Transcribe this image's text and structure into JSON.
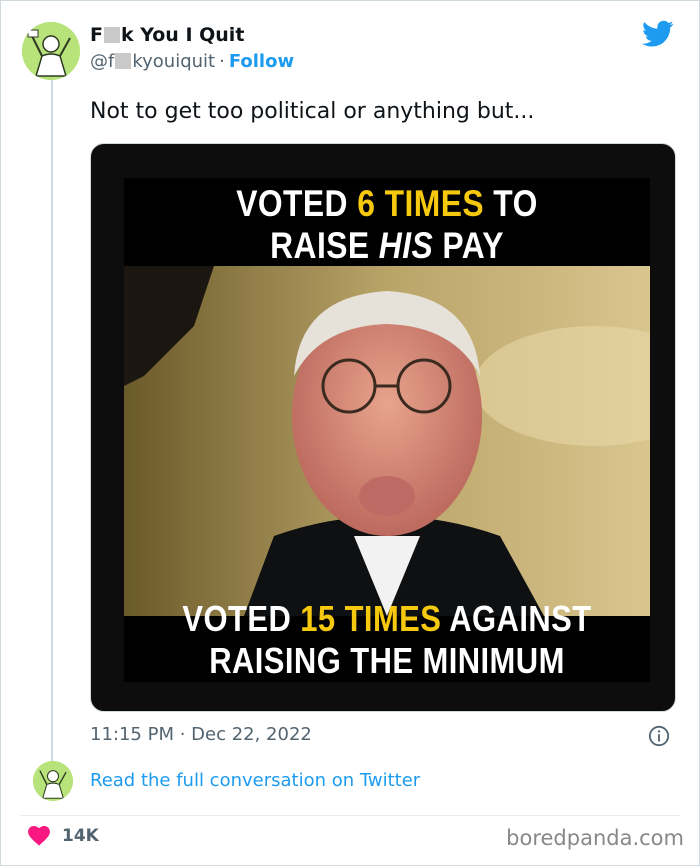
{
  "tweet": {
    "author_name": "F  k You I Quit",
    "author_name_prefix": "F",
    "author_name_suffix": "k You I Quit",
    "handle_prefix": "@f",
    "handle_suffix": "kyouiquit",
    "separator": "·",
    "follow_label": "Follow",
    "text": "Not to get too political or anything but...",
    "timestamp": "11:15 PM · Dec 22, 2022",
    "read_more_label": "Read the full conversation on Twitter",
    "likes": "14K"
  },
  "meme": {
    "line1_a": "VOTED ",
    "line1_b": "6 TIMES",
    "line1_c": " TO",
    "line2_a": "RAISE ",
    "line2_b": "HIS",
    "line2_c": " PAY",
    "line3_a": "VOTED ",
    "line3_b": "15 TIMES",
    "line3_c": " AGAINST",
    "line4": "RAISING THE MINIMUM WAGE."
  },
  "watermark": "boredpanda.com",
  "colors": {
    "accent": "#1d9bf0",
    "meme_highlight": "#f6c90e",
    "like": "#f91880"
  },
  "icons": [
    "twitter-bird-icon",
    "info-icon",
    "heart-icon"
  ]
}
